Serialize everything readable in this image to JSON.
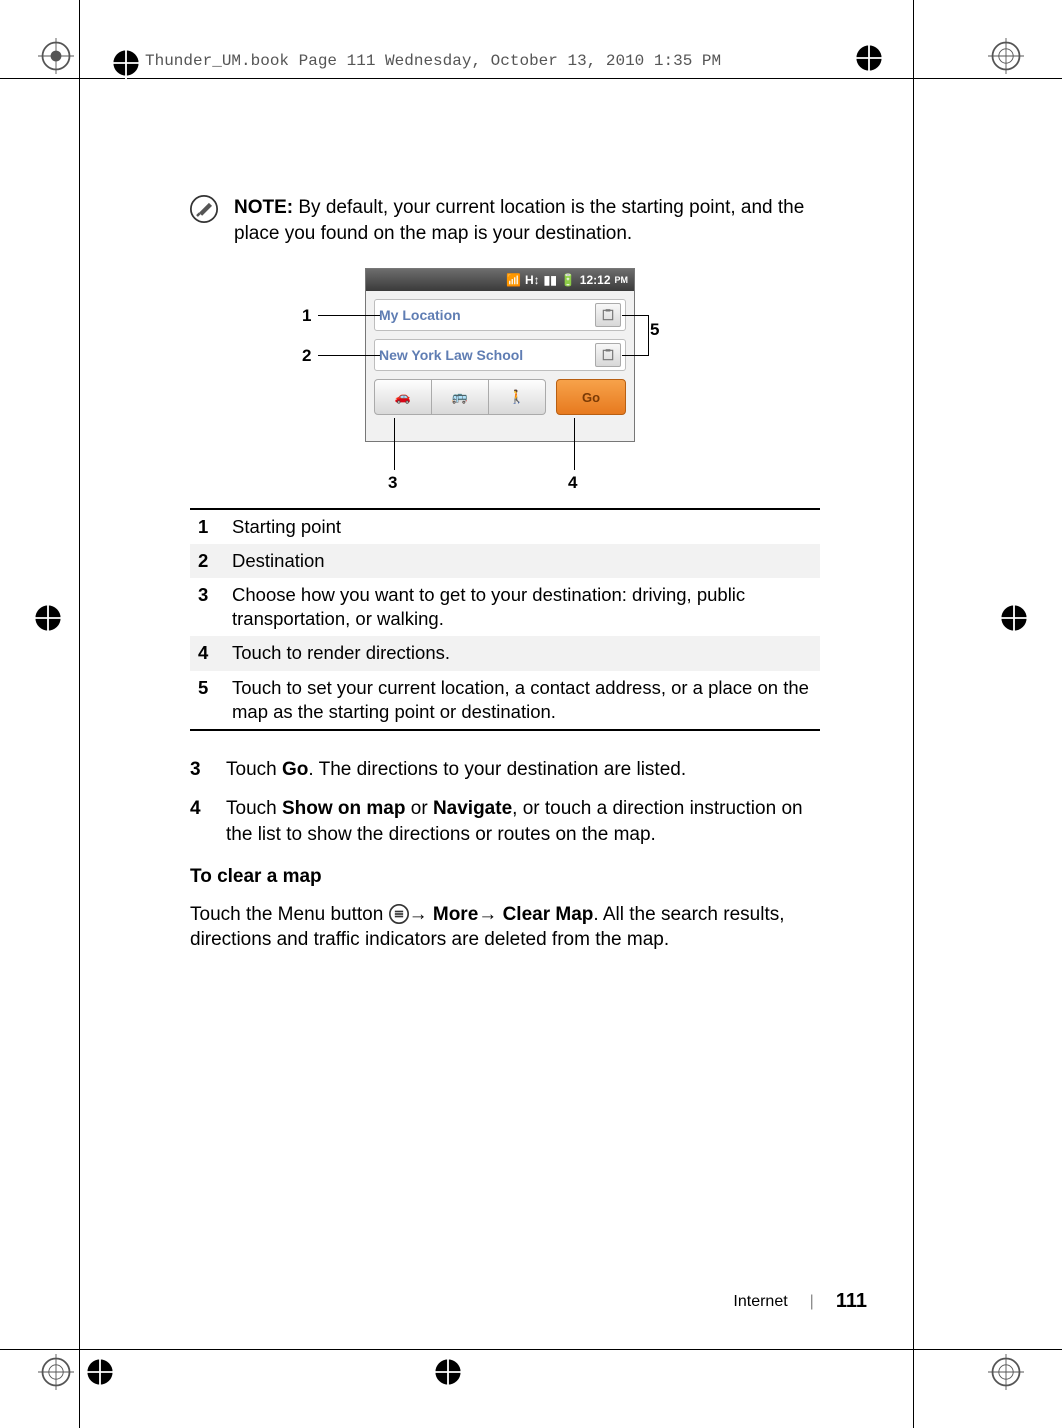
{
  "header_stamp": "Thunder_UM.book  Page 111  Wednesday, October 13, 2010  1:35 PM",
  "note": {
    "label": "NOTE:",
    "text_1": " By default, your current location is the starting point, and the place you found on the map is your destination."
  },
  "callouts": {
    "c1": "1",
    "c2": "2",
    "c3": "3",
    "c4": "4",
    "c5": "5"
  },
  "screenshot": {
    "time": "12:12",
    "time_suffix": "PM",
    "field1": "My Location",
    "field2": "New York Law School",
    "go": "Go"
  },
  "legend": [
    {
      "n": "1",
      "t": "Starting point"
    },
    {
      "n": "2",
      "t": "Destination"
    },
    {
      "n": "3",
      "t": "Choose how you want to get to your destination: driving, public transportation, or walking."
    },
    {
      "n": "4",
      "t": "Touch to render directions."
    },
    {
      "n": "5",
      "t": "Touch to set your current location, a contact address, or a place on the map as the starting point or destination."
    }
  ],
  "steps": {
    "s3_n": "3",
    "s3_a": "Touch ",
    "s3_b": "Go",
    "s3_c": ". The directions to your destination are listed.",
    "s4_n": "4",
    "s4_a": "Touch ",
    "s4_b": "Show on map",
    "s4_c": " or ",
    "s4_d": "Navigate",
    "s4_e": ", or touch a direction instruction on the list to show the directions or routes on the map."
  },
  "clear_heading": "To clear a map",
  "clear": {
    "a": "Touch the Menu button ",
    "arrow1": "→ ",
    "b": "More",
    "arrow2": "→ ",
    "c": "Clear Map",
    "d": ". All the search results, directions and traffic indicators are deleted from the map."
  },
  "footer": {
    "section": "Internet",
    "page": "111"
  }
}
